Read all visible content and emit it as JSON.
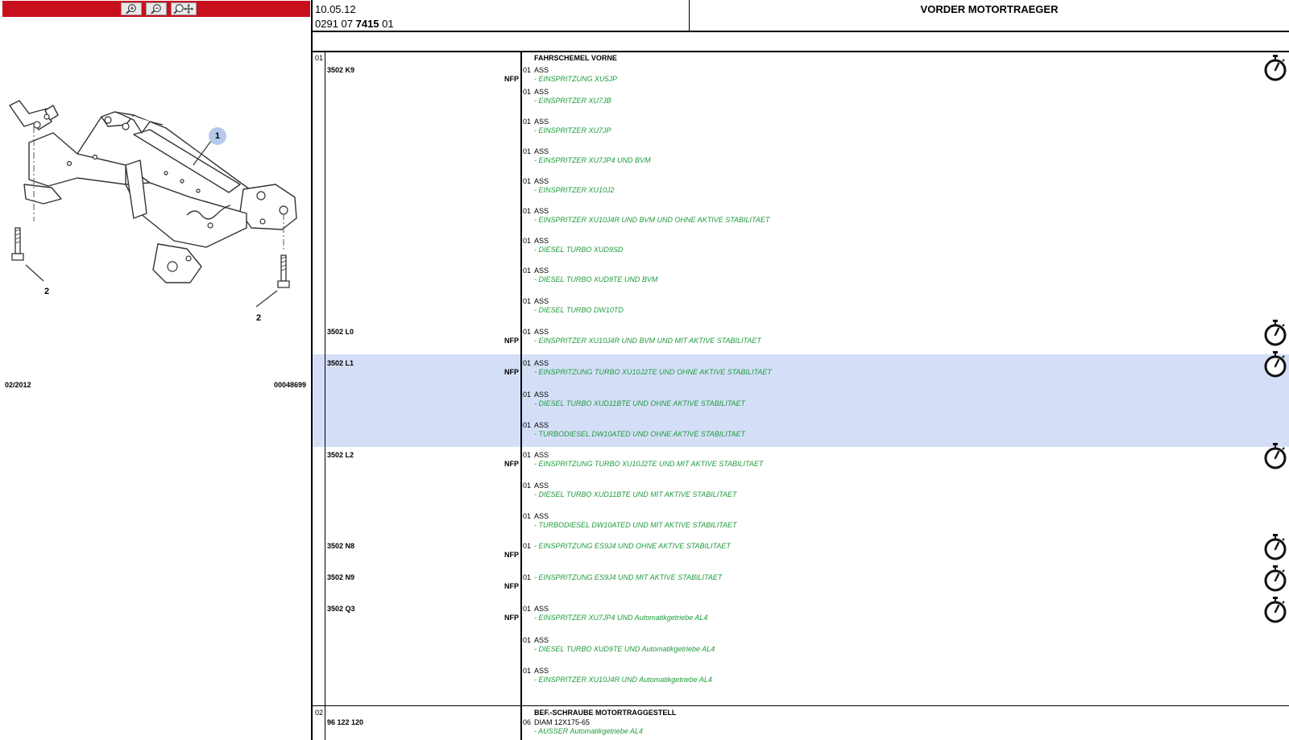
{
  "toolbar": {
    "buttons": [
      {
        "name": "zoom-in",
        "icon": "zoom-in-icon"
      },
      {
        "name": "zoom-out",
        "icon": "zoom-out-icon"
      },
      {
        "name": "zoom-pan",
        "icon": "zoom-pan-icon"
      }
    ],
    "accent_color": "#c8101d"
  },
  "diagram": {
    "callouts": [
      "1",
      "2",
      "2"
    ],
    "date": "02/2012",
    "ref": "00048699"
  },
  "header": {
    "date": "10.05.12",
    "code_prefix": "0291 07 ",
    "code_bold": "7415",
    "code_suffix": " 01",
    "title": "VORDER MOTORTRAEGER"
  },
  "colors": {
    "highlight": "#d4dff7",
    "desc_green": "#1e9c3c"
  },
  "table": {
    "section1": {
      "pos": "01",
      "title": "FAHRSCHEMEL VORNE",
      "groups": [
        {
          "part": "3502 K9",
          "nfp": "NFP",
          "items": [
            {
              "qty": "01",
              "label": "ASS",
              "desc": "- EINSPRITZUNG XU5JP"
            },
            {
              "qty": "01",
              "label": "ASS",
              "desc": "- EINSPRITZER XU7JB"
            },
            {
              "qty": "01",
              "label": "ASS",
              "desc": "- EINSPRITZER XU7JP"
            },
            {
              "qty": "01",
              "label": "ASS",
              "desc": "- EINSPRITZER XU7JP4 UND BVM"
            },
            {
              "qty": "01",
              "label": "ASS",
              "desc": "- EINSPRITZER XU10J2"
            },
            {
              "qty": "01",
              "label": "ASS",
              "desc": "- EINSPRITZER XU10J4R UND BVM UND OHNE AKTIVE STABILITAET"
            },
            {
              "qty": "01",
              "label": "ASS",
              "desc": "- DIESEL TURBO XUD9SD"
            },
            {
              "qty": "01",
              "label": "ASS",
              "desc": "- DIESEL TURBO XUD9TE UND BVM"
            },
            {
              "qty": "01",
              "label": "ASS",
              "desc": "- DIESEL TURBO DW10TD"
            }
          ]
        },
        {
          "part": "3502 L0",
          "nfp": "NFP",
          "items": [
            {
              "qty": "01",
              "label": "ASS",
              "desc": "- EINSPRITZER XU10J4R UND BVM UND MIT AKTIVE STABILITAET"
            }
          ]
        },
        {
          "part": "3502 L1",
          "nfp": "NFP",
          "highlight": true,
          "items": [
            {
              "qty": "01",
              "label": "ASS",
              "desc": "- EINSPRITZUNG TURBO XU10J2TE UND OHNE AKTIVE STABILITAET"
            },
            {
              "qty": "01",
              "label": "ASS",
              "desc": "- DIESEL TURBO XUD11BTE UND OHNE AKTIVE STABILITAET"
            },
            {
              "qty": "01",
              "label": "ASS",
              "desc": "- TURBODIESEL DW10ATED UND OHNE AKTIVE STABILITAET"
            }
          ]
        },
        {
          "part": "3502 L2",
          "nfp": "NFP",
          "items": [
            {
              "qty": "01",
              "label": "ASS",
              "desc": "- EINSPRITZUNG TURBO XU10J2TE UND MIT AKTIVE STABILITAET"
            },
            {
              "qty": "01",
              "label": "ASS",
              "desc": "- DIESEL TURBO XUD11BTE UND MIT AKTIVE STABILITAET"
            },
            {
              "qty": "01",
              "label": "ASS",
              "desc": "- TURBODIESEL DW10ATED UND MIT AKTIVE STABILITAET"
            }
          ]
        },
        {
          "part": "3502 N8",
          "nfp": "NFP",
          "items": [
            {
              "qty": "01",
              "label": "",
              "desc": "- EINSPRITZUNG ES9J4 UND OHNE AKTIVE STABILITAET"
            }
          ]
        },
        {
          "part": "3502 N9",
          "nfp": "NFP",
          "items": [
            {
              "qty": "01",
              "label": "",
              "desc": "- EINSPRITZUNG ES9J4 UND MIT AKTIVE STABILITAET"
            }
          ]
        },
        {
          "part": "3502 Q3",
          "nfp": "NFP",
          "items": [
            {
              "qty": "01",
              "label": "ASS",
              "desc": "- EINSPRITZER XU7JP4 UND Automatikgetriebe AL4"
            },
            {
              "qty": "01",
              "label": "ASS",
              "desc": "- DIESEL TURBO XUD9TE UND Automatikgetriebe AL4"
            },
            {
              "qty": "01",
              "label": "ASS",
              "desc": "- EINSPRITZER XU10J4R UND Automatikgetriebe AL4"
            }
          ]
        }
      ]
    },
    "section2": {
      "pos": "02",
      "title": "BEF.-SCHRAUBE MOTORTRAGGESTELL",
      "part": "96 122 120",
      "qty": "06",
      "label": "DIAM 12X175-65",
      "desc": "- AUSSER Automatikgetriebe AL4"
    },
    "timer_icon": "stopwatch-icon"
  }
}
